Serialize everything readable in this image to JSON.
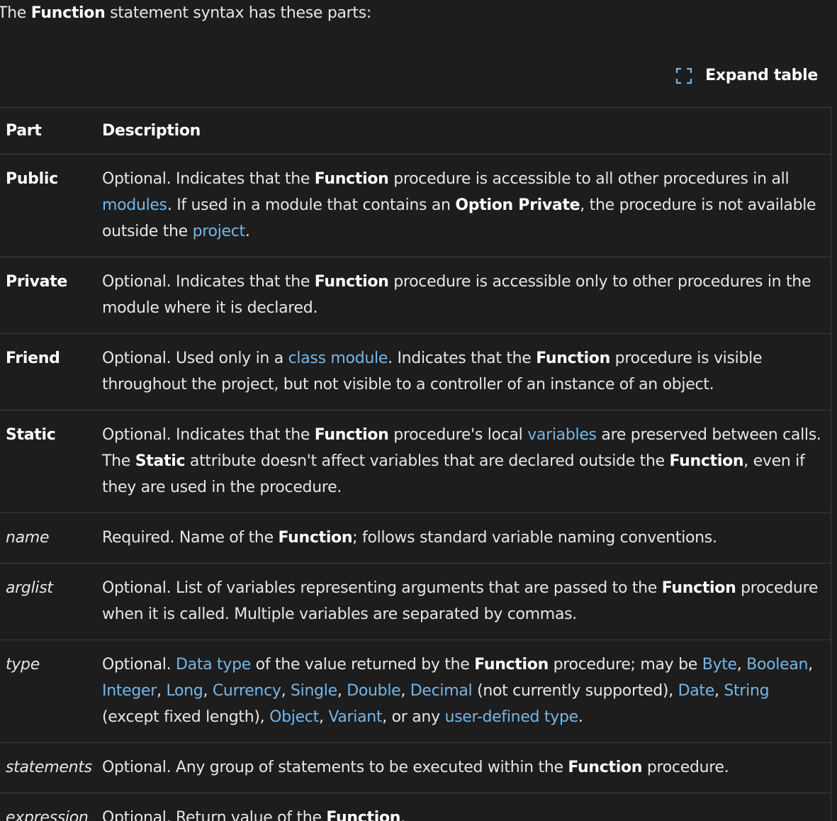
{
  "intro": {
    "pre": "The ",
    "keyword": "Function",
    "post": " statement syntax has these parts:"
  },
  "expand": {
    "label": "Expand table",
    "icon": "expand-icon"
  },
  "table": {
    "headers": [
      "Part",
      "Description"
    ],
    "rows": [
      {
        "part": "Public",
        "style": "bold",
        "segments": [
          {
            "t": "Optional. Indicates that the "
          },
          {
            "t": "Function",
            "k": "b"
          },
          {
            "t": " procedure is accessible to all other procedures in all "
          },
          {
            "t": "modules",
            "k": "a"
          },
          {
            "t": ". If used in a module that contains an "
          },
          {
            "t": "Option Private",
            "k": "b"
          },
          {
            "t": ", the procedure is not available outside the "
          },
          {
            "t": "project",
            "k": "a"
          },
          {
            "t": "."
          }
        ]
      },
      {
        "part": "Private",
        "style": "bold",
        "segments": [
          {
            "t": "Optional. Indicates that the "
          },
          {
            "t": "Function",
            "k": "b"
          },
          {
            "t": " procedure is accessible only to other procedures in the module where it is declared."
          }
        ]
      },
      {
        "part": "Friend",
        "style": "bold",
        "segments": [
          {
            "t": "Optional. Used only in a "
          },
          {
            "t": "class module",
            "k": "a"
          },
          {
            "t": ". Indicates that the "
          },
          {
            "t": "Function",
            "k": "b"
          },
          {
            "t": " procedure is visible throughout the project, but not visible to a controller of an instance of an object."
          }
        ]
      },
      {
        "part": "Static",
        "style": "bold",
        "segments": [
          {
            "t": "Optional. Indicates that the "
          },
          {
            "t": "Function",
            "k": "b"
          },
          {
            "t": " procedure's local "
          },
          {
            "t": "variables",
            "k": "a"
          },
          {
            "t": " are preserved between calls. The "
          },
          {
            "t": "Static",
            "k": "b"
          },
          {
            "t": " attribute doesn't affect variables that are declared outside the "
          },
          {
            "t": "Function",
            "k": "b"
          },
          {
            "t": ", even if they are used in the procedure."
          }
        ]
      },
      {
        "part": "name",
        "style": "italic",
        "segments": [
          {
            "t": "Required. Name of the "
          },
          {
            "t": "Function",
            "k": "b"
          },
          {
            "t": "; follows standard variable naming conventions."
          }
        ]
      },
      {
        "part": "arglist",
        "style": "italic",
        "segments": [
          {
            "t": "Optional. List of variables representing arguments that are passed to the "
          },
          {
            "t": "Function",
            "k": "b"
          },
          {
            "t": " procedure when it is called. Multiple variables are separated by commas."
          }
        ]
      },
      {
        "part": "type",
        "style": "italic",
        "segments": [
          {
            "t": "Optional. "
          },
          {
            "t": "Data type",
            "k": "a"
          },
          {
            "t": " of the value returned by the "
          },
          {
            "t": "Function",
            "k": "b"
          },
          {
            "t": " procedure; may be "
          },
          {
            "t": "Byte",
            "k": "a"
          },
          {
            "t": ", "
          },
          {
            "t": "Boolean",
            "k": "a"
          },
          {
            "t": ", "
          },
          {
            "t": "Integer",
            "k": "a"
          },
          {
            "t": ", "
          },
          {
            "t": "Long",
            "k": "a"
          },
          {
            "t": ", "
          },
          {
            "t": "Currency",
            "k": "a"
          },
          {
            "t": ", "
          },
          {
            "t": "Single",
            "k": "a"
          },
          {
            "t": ", "
          },
          {
            "t": "Double",
            "k": "a"
          },
          {
            "t": ", "
          },
          {
            "t": "Decimal",
            "k": "a"
          },
          {
            "t": " (not currently supported), "
          },
          {
            "t": "Date",
            "k": "a"
          },
          {
            "t": ", "
          },
          {
            "t": "String",
            "k": "a"
          },
          {
            "t": " (except fixed length), "
          },
          {
            "t": "Object",
            "k": "a"
          },
          {
            "t": ", "
          },
          {
            "t": "Variant",
            "k": "a"
          },
          {
            "t": ", or any "
          },
          {
            "t": "user-defined type",
            "k": "a"
          },
          {
            "t": "."
          }
        ]
      },
      {
        "part": "statements",
        "style": "italic",
        "segments": [
          {
            "t": "Optional. Any group of statements to be executed within the "
          },
          {
            "t": "Function",
            "k": "b"
          },
          {
            "t": " procedure."
          }
        ]
      },
      {
        "part": "expression",
        "style": "italic",
        "segments": [
          {
            "t": "Optional. Return value of the "
          },
          {
            "t": "Function",
            "k": "b"
          },
          {
            "t": "."
          }
        ]
      }
    ]
  },
  "colors": {
    "background": "#1d1d1d",
    "text": "#e6e6e6",
    "link": "#75b6e7",
    "border": "#3d3d3d"
  }
}
